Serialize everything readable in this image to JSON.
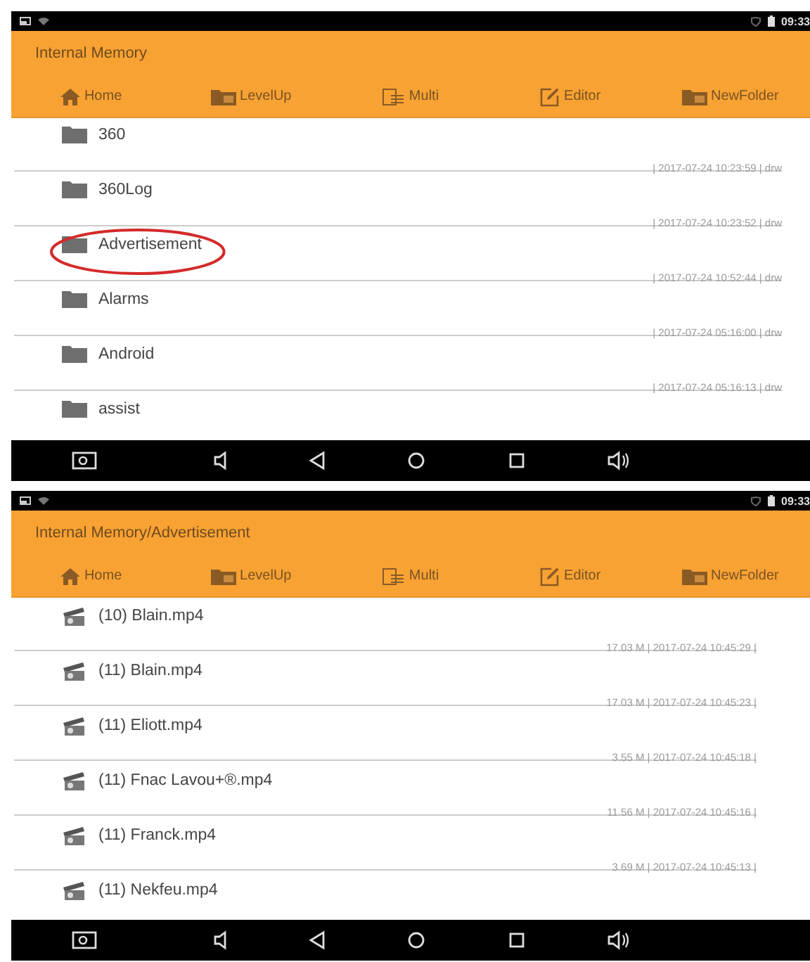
{
  "screens": [
    {
      "status_bar": {
        "time": "09:33"
      },
      "title": "Internal Memory",
      "toolbar": [
        {
          "kind": "home",
          "label": "Home"
        },
        {
          "kind": "levelup",
          "label": "LevelUp"
        },
        {
          "kind": "multi",
          "label": "Multi"
        },
        {
          "kind": "editor",
          "label": "Editor"
        },
        {
          "kind": "newfolder",
          "label": "NewFolder"
        }
      ],
      "items": [
        {
          "kind": "folder",
          "name": "360",
          "meta": "| 2017-07-24 10:23:59 | drw",
          "circled": false
        },
        {
          "kind": "folder",
          "name": "360Log",
          "meta": "| 2017-07-24 10:23:52 | drw",
          "circled": false
        },
        {
          "kind": "folder",
          "name": "Advertisement",
          "meta": "| 2017-07-24 10:52:44 | drw",
          "circled": true
        },
        {
          "kind": "folder",
          "name": "Alarms",
          "meta": "| 2017-07-24 05:16:00 | drw",
          "circled": false
        },
        {
          "kind": "folder",
          "name": "Android",
          "meta": "| 2017-07-24 05:16:13 | drw",
          "circled": false
        },
        {
          "kind": "folder",
          "name": "assist",
          "circled": false
        }
      ]
    },
    {
      "status_bar": {
        "time": "09:33"
      },
      "title": "Internal Memory/Advertisement",
      "toolbar": [
        {
          "kind": "home",
          "label": "Home"
        },
        {
          "kind": "levelup",
          "label": "LevelUp"
        },
        {
          "kind": "multi",
          "label": "Multi"
        },
        {
          "kind": "editor",
          "label": "Editor"
        },
        {
          "kind": "newfolder",
          "label": "NewFolder"
        }
      ],
      "items": [
        {
          "kind": "video",
          "name": "(10) Blain.mp4",
          "meta": "17.03 M | 2017-07-24 10:45:29 |",
          "circled": false
        },
        {
          "kind": "video",
          "name": "(11) Blain.mp4",
          "meta": "17.03 M | 2017-07-24 10:45:23 |",
          "circled": false
        },
        {
          "kind": "video",
          "name": "(11) Eliott.mp4",
          "meta": "3.55 M | 2017-07-24 10:45:18 |",
          "circled": false
        },
        {
          "kind": "video",
          "name": "(11) Fnac Lavou+®.mp4",
          "meta": "11.56 M | 2017-07-24 10:45:16 |",
          "circled": false
        },
        {
          "kind": "video",
          "name": "(11) Franck.mp4",
          "meta": "3.69 M | 2017-07-24 10:45:13 |",
          "circled": false
        },
        {
          "kind": "video",
          "name": "(11) Nekfeu.mp4",
          "circled": false
        }
      ]
    }
  ]
}
